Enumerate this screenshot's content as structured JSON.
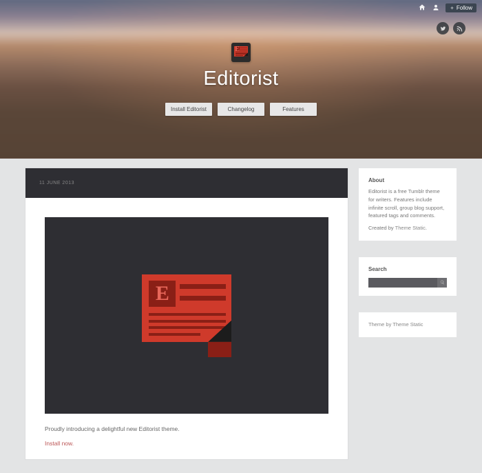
{
  "topbar": {
    "follow_label": "Follow"
  },
  "hero": {
    "title": "Editorist",
    "nav": {
      "install": "Install Editorist",
      "changelog": "Changelog",
      "features": "Features"
    }
  },
  "post": {
    "date": "11 JUNE 2013",
    "caption": "Proudly introducing a delightful new Editorist theme.",
    "install_link": "Install now."
  },
  "sidebar": {
    "about": {
      "heading": "About",
      "body": "Editorist is a free Tumblr theme for writers. Features include infinite scroll, group blog support, featured tags and comments.",
      "created_prefix": "Created by ",
      "created_link": "Theme Static",
      "period": "."
    },
    "search": {
      "heading": "Search",
      "placeholder": ""
    },
    "themeby": {
      "prefix": "Theme by ",
      "link": "Theme Static"
    }
  }
}
